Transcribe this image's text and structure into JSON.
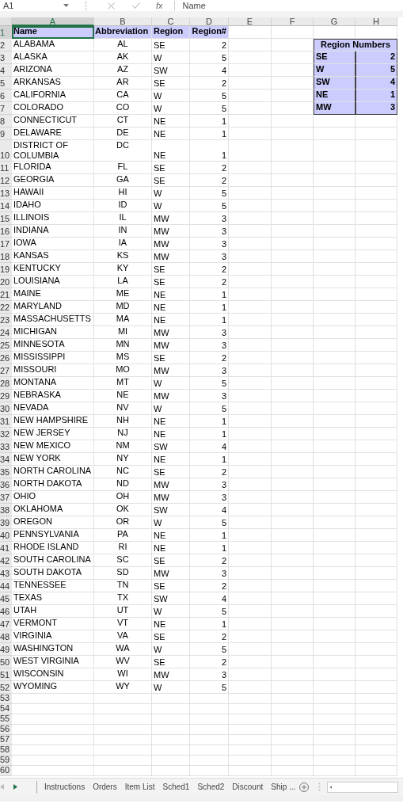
{
  "formula_bar": {
    "name_box": "A1",
    "function_label": "fx",
    "formula": "Name"
  },
  "column_headers": [
    {
      "label": "A",
      "selected": true
    },
    {
      "label": "B",
      "selected": false
    },
    {
      "label": "C",
      "selected": false
    },
    {
      "label": "D",
      "selected": false
    },
    {
      "label": "E",
      "selected": false
    },
    {
      "label": "F",
      "selected": false
    },
    {
      "label": "G",
      "selected": false
    },
    {
      "label": "H",
      "selected": false
    }
  ],
  "rows": [
    {
      "row": "1",
      "name": "Name",
      "abbreviation": "Abbreviation",
      "region": "Region",
      "region_no": "Region#",
      "kind": "header",
      "selected": true
    },
    {
      "row": "2",
      "name": "ALABAMA",
      "abbreviation": "AL",
      "region": "SE",
      "region_no": "2"
    },
    {
      "row": "3",
      "name": "ALASKA",
      "abbreviation": "AK",
      "region": "W",
      "region_no": "5"
    },
    {
      "row": "4",
      "name": "ARIZONA",
      "abbreviation": "AZ",
      "region": "SW",
      "region_no": "4"
    },
    {
      "row": "5",
      "name": "ARKANSAS",
      "abbreviation": "AR",
      "region": "SE",
      "region_no": "2"
    },
    {
      "row": "6",
      "name": "CALIFORNIA",
      "abbreviation": "CA",
      "region": "W",
      "region_no": "5"
    },
    {
      "row": "7",
      "name": "COLORADO",
      "abbreviation": "CO",
      "region": "W",
      "region_no": "5"
    },
    {
      "row": "8",
      "name": "CONNECTICUT",
      "abbreviation": "CT",
      "region": "NE",
      "region_no": "1"
    },
    {
      "row": "9",
      "name": "DELAWARE",
      "abbreviation": "DE",
      "region": "NE",
      "region_no": "1"
    },
    {
      "row": "10",
      "name": "DISTRICT OF COLUMBIA",
      "abbreviation": "DC",
      "region": "NE",
      "region_no": "1"
    },
    {
      "row": "11",
      "name": "FLORIDA",
      "abbreviation": "FL",
      "region": "SE",
      "region_no": "2"
    },
    {
      "row": "12",
      "name": "GEORGIA",
      "abbreviation": "GA",
      "region": "SE",
      "region_no": "2"
    },
    {
      "row": "13",
      "name": "HAWAII",
      "abbreviation": "HI",
      "region": "W",
      "region_no": "5"
    },
    {
      "row": "14",
      "name": "IDAHO",
      "abbreviation": "ID",
      "region": "W",
      "region_no": "5"
    },
    {
      "row": "15",
      "name": "ILLINOIS",
      "abbreviation": "IL",
      "region": "MW",
      "region_no": "3"
    },
    {
      "row": "16",
      "name": "INDIANA",
      "abbreviation": "IN",
      "region": "MW",
      "region_no": "3"
    },
    {
      "row": "17",
      "name": "IOWA",
      "abbreviation": "IA",
      "region": "MW",
      "region_no": "3"
    },
    {
      "row": "18",
      "name": "KANSAS",
      "abbreviation": "KS",
      "region": "MW",
      "region_no": "3"
    },
    {
      "row": "19",
      "name": "KENTUCKY",
      "abbreviation": "KY",
      "region": "SE",
      "region_no": "2"
    },
    {
      "row": "20",
      "name": "LOUISIANA",
      "abbreviation": "LA",
      "region": "SE",
      "region_no": "2"
    },
    {
      "row": "21",
      "name": "MAINE",
      "abbreviation": "ME",
      "region": "NE",
      "region_no": "1"
    },
    {
      "row": "22",
      "name": "MARYLAND",
      "abbreviation": "MD",
      "region": "NE",
      "region_no": "1"
    },
    {
      "row": "23",
      "name": "MASSACHUSETTS",
      "abbreviation": "MA",
      "region": "NE",
      "region_no": "1"
    },
    {
      "row": "24",
      "name": "MICHIGAN",
      "abbreviation": "MI",
      "region": "MW",
      "region_no": "3"
    },
    {
      "row": "25",
      "name": "MINNESOTA",
      "abbreviation": "MN",
      "region": "MW",
      "region_no": "3"
    },
    {
      "row": "26",
      "name": "MISSISSIPPI",
      "abbreviation": "MS",
      "region": "SE",
      "region_no": "2"
    },
    {
      "row": "27",
      "name": "MISSOURI",
      "abbreviation": "MO",
      "region": "MW",
      "region_no": "3"
    },
    {
      "row": "28",
      "name": "MONTANA",
      "abbreviation": "MT",
      "region": "W",
      "region_no": "5"
    },
    {
      "row": "29",
      "name": "NEBRASKA",
      "abbreviation": "NE",
      "region": "MW",
      "region_no": "3"
    },
    {
      "row": "30",
      "name": "NEVADA",
      "abbreviation": "NV",
      "region": "W",
      "region_no": "5"
    },
    {
      "row": "31",
      "name": "NEW HAMPSHIRE",
      "abbreviation": "NH",
      "region": "NE",
      "region_no": "1"
    },
    {
      "row": "32",
      "name": "NEW JERSEY",
      "abbreviation": "NJ",
      "region": "NE",
      "region_no": "1"
    },
    {
      "row": "33",
      "name": "NEW MEXICO",
      "abbreviation": "NM",
      "region": "SW",
      "region_no": "4"
    },
    {
      "row": "34",
      "name": "NEW YORK",
      "abbreviation": "NY",
      "region": "NE",
      "region_no": "1"
    },
    {
      "row": "35",
      "name": "NORTH CAROLINA",
      "abbreviation": "NC",
      "region": "SE",
      "region_no": "2"
    },
    {
      "row": "36",
      "name": "NORTH DAKOTA",
      "abbreviation": "ND",
      "region": "MW",
      "region_no": "3"
    },
    {
      "row": "37",
      "name": "OHIO",
      "abbreviation": "OH",
      "region": "MW",
      "region_no": "3"
    },
    {
      "row": "38",
      "name": "OKLAHOMA",
      "abbreviation": "OK",
      "region": "SW",
      "region_no": "4"
    },
    {
      "row": "39",
      "name": "OREGON",
      "abbreviation": "OR",
      "region": "W",
      "region_no": "5"
    },
    {
      "row": "40",
      "name": "PENNSYLVANIA",
      "abbreviation": "PA",
      "region": "NE",
      "region_no": "1"
    },
    {
      "row": "41",
      "name": "RHODE ISLAND",
      "abbreviation": "RI",
      "region": "NE",
      "region_no": "1"
    },
    {
      "row": "42",
      "name": "SOUTH CAROLINA",
      "abbreviation": "SC",
      "region": "SE",
      "region_no": "2"
    },
    {
      "row": "43",
      "name": "SOUTH DAKOTA",
      "abbreviation": "SD",
      "region": "MW",
      "region_no": "3"
    },
    {
      "row": "44",
      "name": "TENNESSEE",
      "abbreviation": "TN",
      "region": "SE",
      "region_no": "2"
    },
    {
      "row": "45",
      "name": "TEXAS",
      "abbreviation": "TX",
      "region": "SW",
      "region_no": "4"
    },
    {
      "row": "46",
      "name": "UTAH",
      "abbreviation": "UT",
      "region": "W",
      "region_no": "5"
    },
    {
      "row": "47",
      "name": "VERMONT",
      "abbreviation": "VT",
      "region": "NE",
      "region_no": "1"
    },
    {
      "row": "48",
      "name": "VIRGINIA",
      "abbreviation": "VA",
      "region": "SE",
      "region_no": "2"
    },
    {
      "row": "49",
      "name": "WASHINGTON",
      "abbreviation": "WA",
      "region": "W",
      "region_no": "5"
    },
    {
      "row": "50",
      "name": "WEST VIRGINIA",
      "abbreviation": "WV",
      "region": "SE",
      "region_no": "2"
    },
    {
      "row": "51",
      "name": "WISCONSIN",
      "abbreviation": "WI",
      "region": "MW",
      "region_no": "3"
    },
    {
      "row": "52",
      "name": "WYOMING",
      "abbreviation": "WY",
      "region": "W",
      "region_no": "5"
    },
    {
      "row": "53"
    },
    {
      "row": "54"
    },
    {
      "row": "55"
    },
    {
      "row": "56"
    },
    {
      "row": "57"
    },
    {
      "row": "58"
    },
    {
      "row": "59"
    },
    {
      "row": "60"
    }
  ],
  "region_numbers": {
    "title": "Region Numbers",
    "entries": [
      {
        "region": "SE",
        "number": "2"
      },
      {
        "region": "W",
        "number": "5"
      },
      {
        "region": "SW",
        "number": "4"
      },
      {
        "region": "NE",
        "number": "1"
      },
      {
        "region": "MW",
        "number": "3"
      }
    ]
  },
  "sheet_tabs": [
    {
      "label": "Instructions",
      "selected": false
    },
    {
      "label": "Orders",
      "selected": false
    },
    {
      "label": "Item List",
      "selected": false
    },
    {
      "label": "Sched1",
      "selected": false
    },
    {
      "label": "Sched2",
      "selected": false
    },
    {
      "label": "Discount",
      "selected": false
    },
    {
      "label": "Ship ...",
      "selected": false
    }
  ]
}
